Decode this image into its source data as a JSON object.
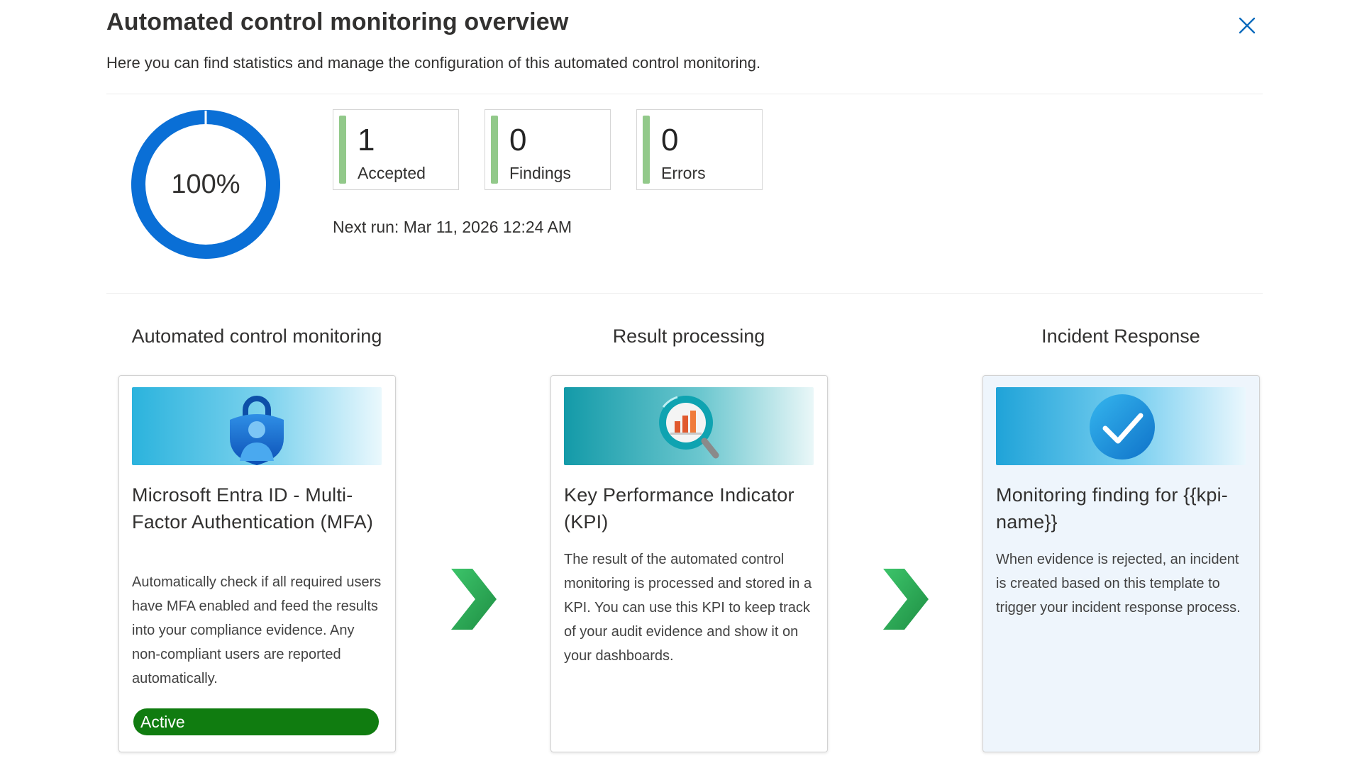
{
  "header": {
    "title": "Automated control monitoring overview",
    "subtitle": "Here you can find statistics and manage the configuration of this automated control monitoring."
  },
  "summary": {
    "progress_percent": 100,
    "progress_label": "100%",
    "stats": [
      {
        "value": "1",
        "label": "Accepted"
      },
      {
        "value": "0",
        "label": "Findings"
      },
      {
        "value": "0",
        "label": "Errors"
      }
    ],
    "next_run": "Next run: Mar 11, 2026 12:24 AM"
  },
  "workflow": {
    "columns": [
      {
        "header": "Automated control monitoring",
        "title": "Microsoft Entra ID - Multi-Factor Authentication (MFA)",
        "description": "Automatically check if all required users have MFA enabled and feed the results into your compliance evidence. Any non-compliant users are reported automatically.",
        "icon": "lock-user-icon",
        "status": "Active"
      },
      {
        "header": "Result processing",
        "title": "Key Performance Indicator (KPI)",
        "description": "The result of the automated control monitoring is processed and stored in a KPI. You can use this KPI to keep track of your audit evidence and show it on your dashboards.",
        "icon": "chart-magnifier-icon"
      },
      {
        "header": "Incident Response",
        "title": "Monitoring finding for {{kpi-name}}",
        "description": "When evidence is rejected, an incident is created based on this template to trigger your incident response process.",
        "icon": "checkmark-icon"
      }
    ]
  },
  "colors": {
    "progress_ring": "#0a6fd6",
    "stat_bar": "#92c98a",
    "status_active": "#107c10",
    "arrow": "#2ea44f",
    "close_icon": "#0f6cbd"
  }
}
